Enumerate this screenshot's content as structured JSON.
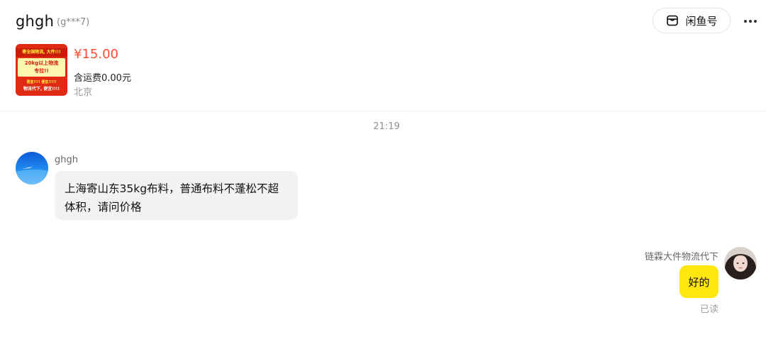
{
  "header": {
    "title": "ghgh",
    "handle": "(g***7)",
    "xianyu_button_label": "闲鱼号"
  },
  "product": {
    "thumbnail_lines": [
      "寄全国物流, 大件!!!",
      "20kg以上物流",
      "专拉!!",
      "便宜!!!! 便宜!!!!!",
      "物流代下, 便宜!!!!"
    ],
    "price": "¥15.00",
    "shipping": "含运费0.00元",
    "location": "北京"
  },
  "chat": {
    "timestamp": "21:19",
    "messages": [
      {
        "sender": "ghgh",
        "text": "上海寄山东35kg布料，普通布料不蓬松不超体积，请问价格",
        "direction": "incoming"
      },
      {
        "sender": "链霖大件物流代下",
        "text": "好的",
        "direction": "outgoing",
        "status": "已读"
      }
    ]
  },
  "colors": {
    "price": "#ff4d2e",
    "incoming_bubble": "#f2f2f4",
    "outgoing_bubble": "#ffe60f",
    "thumbnail_bg": "#e12a13"
  },
  "icons": {
    "xianyu_button": "shop-icon",
    "more": "more-dots-icon"
  }
}
